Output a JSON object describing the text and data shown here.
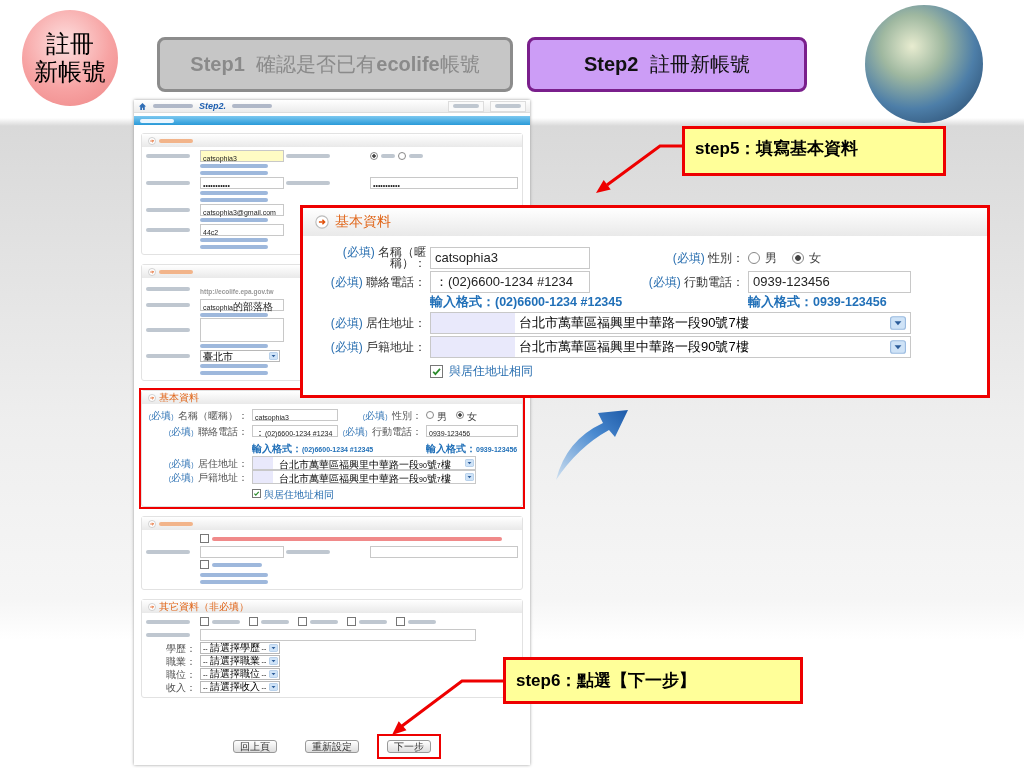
{
  "badge": [
    "註冊",
    "新帳號"
  ],
  "steps": [
    {
      "label": "**Step1** 確認是否已有**ecolife**帳號",
      "selected": false
    },
    {
      "label": "**Step2** 註冊新帳號",
      "selected": true
    }
  ],
  "screenshot": {
    "breadcrumb": {
      "logo": "Step2."
    },
    "sections": [
      {
        "framed": false,
        "rows": [
          {
            "cells": [
              {
                "kind": "text",
                "value": "catsophia3",
                "highlighted": true
              },
              {
                "kind": "radio",
                "options": [
                  {
                    "selected": true
                  },
                  {
                    "selected": false
                  }
                ]
              }
            ],
            "hints": [
              [
                {
                  "kind": "blurred"
                }
              ],
              [
                {
                  "kind": "blurred"
                }
              ]
            ]
          },
          {
            "cells": [
              {
                "kind": "text",
                "value": "•••••••••••"
              },
              {
                "kind": "text",
                "value": "•••••••••••"
              }
            ],
            "hints": [
              [
                {
                  "kind": "blurred"
                }
              ],
              [
                {
                  "kind": "blurred"
                }
              ]
            ]
          },
          {
            "cells": [
              {
                "kind": "text",
                "value": "catsophia3@gmail.com"
              }
            ],
            "hints": [
              [
                {
                  "kind": "blurred"
                }
              ]
            ]
          },
          {
            "cells": [
              {
                "kind": "text",
                "value": "44c2"
              }
            ],
            "hints": [
              [
                {
                  "kind": "blurred"
                }
              ],
              [
                {
                  "kind": "blurred"
                }
              ]
            ]
          }
        ]
      },
      {
        "framed": false,
        "rows": [
          {
            "cells": [
              {
                "kind": "static",
                "value": "http://ecolife.epa.gov.tw"
              }
            ]
          },
          {
            "cells": [
              {
                "kind": "text",
                "value": "catsophia的部落格"
              }
            ],
            "hints": [
              [
                {
                  "kind": "blurred"
                }
              ]
            ]
          },
          {
            "cells": [
              {
                "kind": "textarea"
              }
            ],
            "hints": [
              [
                {
                  "kind": "blurred"
                }
              ]
            ]
          },
          {
            "cells": [
              {
                "kind": "select",
                "value": "臺北市"
              }
            ],
            "hints": [
              [
                {
                  "kind": "blurred"
                }
              ],
              [
                {
                  "kind": "blurred"
                }
              ]
            ]
          }
        ]
      },
      {
        "framed": true,
        "title": "基本資料",
        "rows": [
          {
            "cells": [
              {
                "tag": "(必填)",
                "label": "名稱（暱稱）：",
                "kind": "text",
                "value": "catsophia3"
              },
              {
                "tag": "(必填)",
                "label": "性別：",
                "kind": "radio",
                "options": [
                  {
                    "text": "男",
                    "selected": false
                  },
                  {
                    "text": "女",
                    "selected": true
                  }
                ]
              }
            ]
          },
          {
            "cells": [
              {
                "tag": "(必填)",
                "label": "聯絡電話：",
                "kind": "text",
                "value": "：(02)6600-1234 #1234"
              },
              {
                "tag": "(必填)",
                "label": "行動電話：",
                "kind": "text",
                "value": "0939-123456"
              }
            ],
            "hints": [
              [
                {
                  "kind": "text",
                  "text": "輸入格式：(02)6600-1234 #12345"
                },
                {
                  "kind": "text",
                  "text": "輸入格式：0939-123456"
                }
              ]
            ]
          },
          {
            "cells": [
              {
                "tag": "(必填)",
                "label": "居住地址：",
                "kind": "address",
                "value": "台北市萬華區福興里中華路一段90號7樓"
              }
            ]
          },
          {
            "cells": [
              {
                "tag": "(必填)",
                "label": "戶籍地址：",
                "kind": "address",
                "value": "台北市萬華區福興里中華路一段90號7樓"
              }
            ]
          },
          {
            "cells": [
              {
                "kind": "checkbox",
                "checked": true,
                "text": "與居住地址相同"
              }
            ]
          }
        ]
      },
      {
        "framed": false,
        "rows": [
          {
            "cells": [
              {
                "kind": "checkbox",
                "checked": false,
                "warning": true
              }
            ]
          },
          {
            "cells": [
              {
                "kind": "text"
              },
              {
                "kind": "text"
              }
            ]
          },
          {
            "cells": [
              {
                "kind": "checkbox",
                "checked": false,
                "warning": false
              }
            ],
            "hints": [
              [
                {
                  "kind": "blurred"
                }
              ],
              [
                {
                  "kind": "blurred"
                }
              ]
            ]
          }
        ]
      },
      {
        "framed": false,
        "title": "其它資料（非必填）",
        "rows": [
          {
            "cells": [
              {
                "kind": "checkgroup",
                "options": [
                  {
                    "checked": false
                  },
                  {
                    "checked": false
                  },
                  {
                    "checked": false
                  },
                  {
                    "checked": false
                  },
                  {
                    "checked": false
                  }
                ]
              }
            ]
          },
          {
            "cells": [
              {
                "kind": "text_wide"
              }
            ]
          },
          {
            "cells": [
              {
                "label": "學歷：",
                "kind": "select",
                "value": "-- 請選擇學歷 --"
              }
            ]
          },
          {
            "cells": [
              {
                "label": "職業：",
                "kind": "select",
                "value": "-- 請選擇職業 --"
              }
            ]
          },
          {
            "cells": [
              {
                "label": "職位：",
                "kind": "select",
                "value": "-- 請選擇職位 --"
              }
            ]
          },
          {
            "cells": [
              {
                "label": "收入：",
                "kind": "select",
                "value": "-- 請選擇收入 --"
              }
            ]
          }
        ]
      }
    ],
    "buttons": [
      {
        "text": "回上頁",
        "framed": false
      },
      {
        "text": "重新設定",
        "framed": false
      },
      {
        "text": "下一步",
        "framed": true
      }
    ]
  },
  "zoom_panel": {
    "title": "基本資料",
    "rows": [
      {
        "cells": [
          {
            "tag": "(必填)",
            "label": "名稱（暱稱）：",
            "kind": "text",
            "value": "catsophia3"
          },
          {
            "tag": "(必填)",
            "label": "性別：",
            "kind": "radio",
            "options": [
              {
                "text": "男",
                "selected": false
              },
              {
                "text": "女",
                "selected": true
              }
            ]
          }
        ]
      },
      {
        "cells": [
          {
            "tag": "(必填)",
            "label": "聯絡電話：",
            "kind": "text",
            "value": "：(02)6600-1234 #1234"
          },
          {
            "tag": "(必填)",
            "label": "行動電話：",
            "kind": "text",
            "value": "0939-123456"
          }
        ],
        "hints": [
          [
            {
              "kind": "text",
              "text": "輸入格式：(02)6600-1234 #12345"
            },
            {
              "kind": "text",
              "text": "輸入格式：0939-123456"
            }
          ]
        ]
      },
      {
        "cells": [
          {
            "tag": "(必填)",
            "label": "居住地址：",
            "kind": "address",
            "value": "台北市萬華區福興里中華路一段90號7樓"
          }
        ]
      },
      {
        "cells": [
          {
            "tag": "(必填)",
            "label": "戶籍地址：",
            "kind": "address",
            "value": "台北市萬華區福興里中華路一段90號7樓"
          }
        ]
      },
      {
        "cells": [
          {
            "kind": "checkbox",
            "checked": true,
            "text": "與居住地址相同"
          }
        ]
      }
    ]
  },
  "callouts": [
    {
      "text": "step5：填寫基本資料"
    },
    {
      "text": "step6：點選【下一步】"
    }
  ]
}
